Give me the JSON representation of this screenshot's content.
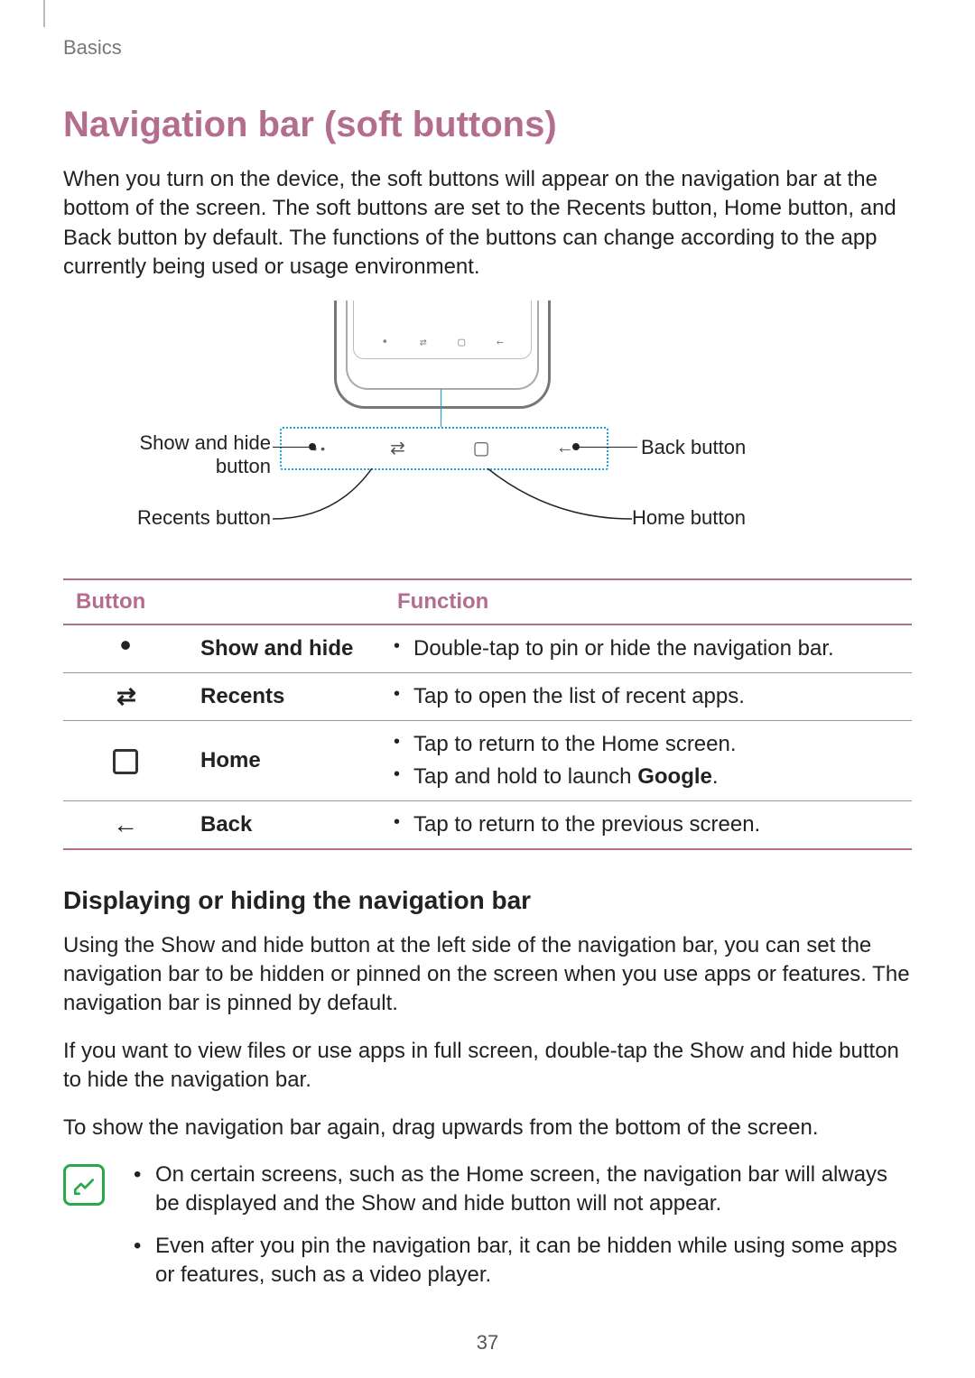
{
  "breadcrumb": "Basics",
  "section_title": "Navigation bar (soft buttons)",
  "intro_paragraph": "When you turn on the device, the soft buttons will appear on the navigation bar at the bottom of the screen. The soft buttons are set to the Recents button, Home button, and Back button by default. The functions of the buttons can change according to the app currently being used or usage environment.",
  "diagram": {
    "label_show_hide_line1": "Show and hide",
    "label_show_hide_line2": "button",
    "label_recents": "Recents button",
    "label_back": "Back button",
    "label_home": "Home button"
  },
  "table": {
    "header_button": "Button",
    "header_function": "Function",
    "rows": [
      {
        "icon_glyph": "•",
        "name": "Show and hide",
        "functions": [
          "Double-tap to pin or hide the navigation bar."
        ]
      },
      {
        "icon_glyph": "⇄",
        "name": "Recents",
        "functions": [
          "Tap to open the list of recent apps."
        ]
      },
      {
        "icon_glyph": "home",
        "name": "Home",
        "functions": [
          "Tap to return to the Home screen.",
          "Tap and hold to launch <b>Google</b>."
        ]
      },
      {
        "icon_glyph": "←",
        "name": "Back",
        "functions": [
          "Tap to return to the previous screen."
        ]
      }
    ]
  },
  "subheading": "Displaying or hiding the navigation bar",
  "paragraphs": [
    "Using the Show and hide button at the left side of the navigation bar, you can set the navigation bar to be hidden or pinned on the screen when you use apps or features. The navigation bar is pinned by default.",
    "If you want to view files or use apps in full screen, double-tap the Show and hide button to hide the navigation bar.",
    "To show the navigation bar again, drag upwards from the bottom of the screen."
  ],
  "notes": [
    "On certain screens, such as the Home screen, the navigation bar will always be displayed and the Show and hide button will not appear.",
    "Even after you pin the navigation bar, it can be hidden while using some apps or features, such as a video player."
  ],
  "page_number": "37"
}
